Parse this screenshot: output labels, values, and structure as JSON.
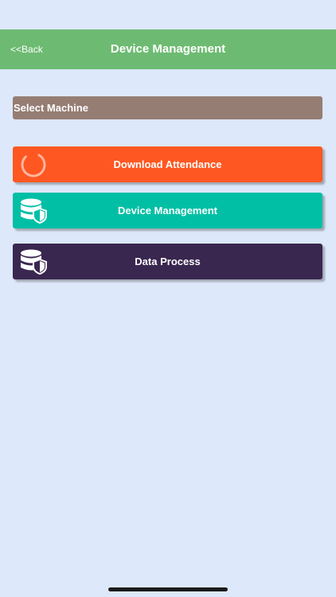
{
  "header": {
    "back_label": "<<Back",
    "title": "Device Management"
  },
  "select_machine": {
    "label": "Select Machine"
  },
  "buttons": {
    "download": {
      "label": "Download Attendance",
      "icon": "loading-spinner-icon",
      "color": "#ff5722"
    },
    "device": {
      "label": "Device Management",
      "icon": "database-shield-icon",
      "color": "#00bfa5"
    },
    "process": {
      "label": "Data Process",
      "icon": "database-shield-icon",
      "color": "#3a2750"
    }
  },
  "colors": {
    "background": "#dde8fb",
    "header": "#6dbb72",
    "select_machine": "#957d73"
  }
}
